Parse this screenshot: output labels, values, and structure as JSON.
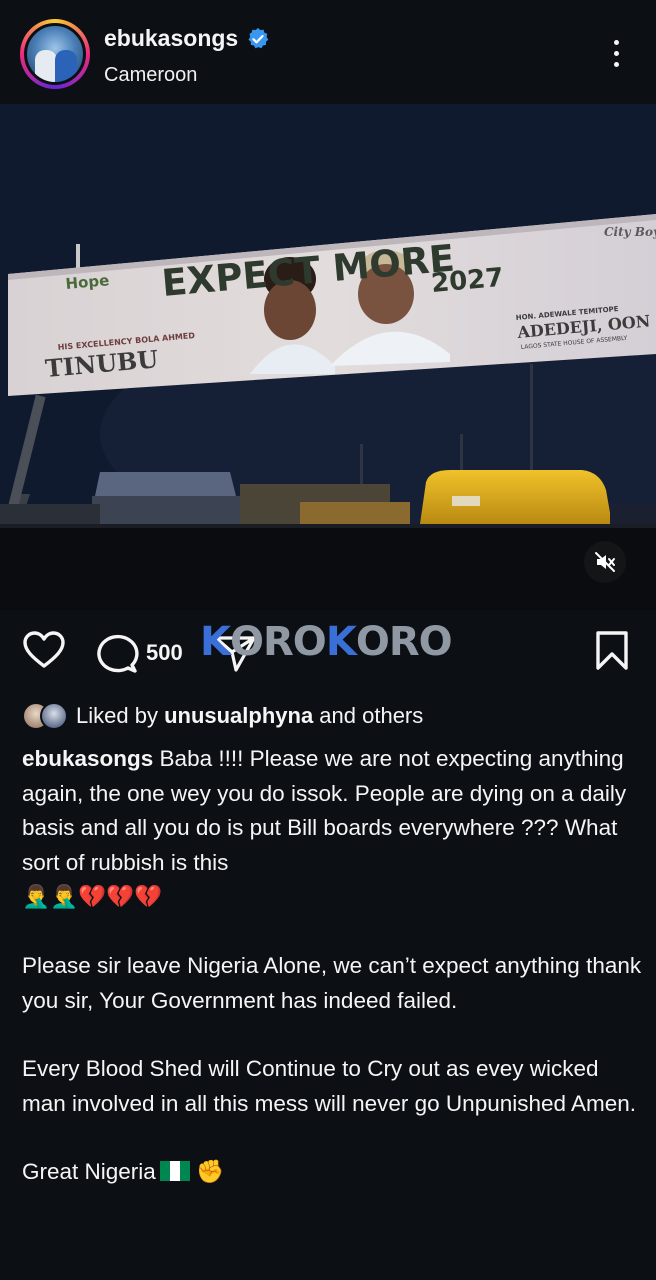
{
  "post": {
    "username": "ebukasongs",
    "location": "Cameroon",
    "comments_count": "500"
  },
  "billboard": {
    "left_brand": "Hope",
    "headline": "EXPECT MORE",
    "year": "2027",
    "left_caption_small": "HIS EXCELLENCY BOLA AHMED",
    "left_name": "TINUBU",
    "right_caption_small": "HON. ADEWALE TEMITOPE",
    "right_name": "ADEDEJI, OON",
    "right_sub": "LAGOS STATE HOUSE OF ASSEMBLY",
    "top_right_logo": "City Boy"
  },
  "watermark": {
    "k": "K",
    "rest": "ORO",
    "k2": "K",
    "rest2": "ORO"
  },
  "likes": {
    "prefix": "Liked by ",
    "user": "unusualphyna",
    "suffix": " and others"
  },
  "caption": {
    "username": "ebukasongs",
    "para1": " Baba !!!! Please we are not expecting anything again, the one wey you do issok. People are dying on a daily basis and all you do is put Bill boards everywhere ??? What sort of rubbish is this",
    "para1_emojis": "🤦‍♂️🤦‍♂️💔💔💔",
    "para2": "Please sir leave Nigeria Alone, we can’t expect anything thank you sir, Your  Government has indeed failed.",
    "para3": "Every Blood Shed will Continue to Cry out as evey wicked man involved in all this mess will never go Unpunished Amen.",
    "para4": "Great Nigeria",
    "para4_emoji": "✊"
  },
  "colors": {
    "background": "#0c1014",
    "verified": "#3897f0",
    "heart_broken": "#e0245e"
  },
  "icons": [
    "verified-badge-icon",
    "more-options-icon",
    "sound-off-icon",
    "heart-icon",
    "comment-icon",
    "share-icon",
    "bookmark-icon"
  ]
}
